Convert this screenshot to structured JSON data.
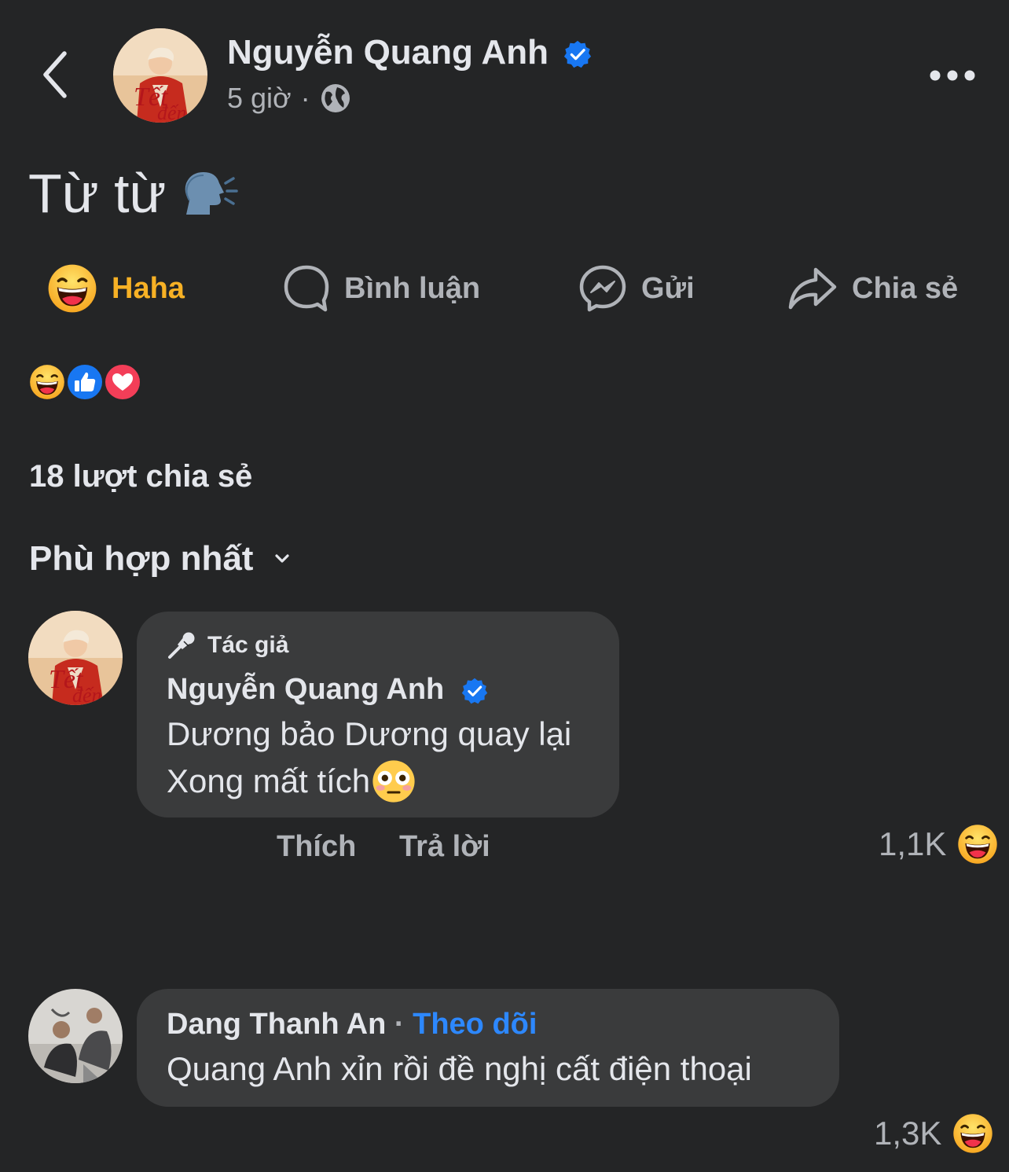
{
  "post": {
    "author": "Nguyễn Quang Anh",
    "time": "5 giờ",
    "separator": "·",
    "text": "Từ từ",
    "text_emoji": "speaking-head-icon"
  },
  "actions": {
    "haha": "Haha",
    "comment": "Bình luận",
    "send": "Gửi",
    "share": "Chia sẻ"
  },
  "reactions": [
    "haha-icon",
    "like-icon",
    "love-icon"
  ],
  "share_count": "18 lượt chia sẻ",
  "sort": {
    "label": "Phù hợp nhất"
  },
  "comments": [
    {
      "badge": "Tác giả",
      "name": "Nguyễn Quang Anh",
      "line1": "Dương bảo Dương quay lại",
      "line2": "Xong mất tích",
      "like": "Thích",
      "reply": "Trả lời",
      "reaction_count": "1,1K"
    },
    {
      "name": "Dang Thanh An",
      "separator": "·",
      "follow": "Theo dõi",
      "text": "Quang Anh xỉn rồi đề nghị cất điện thoại",
      "reaction_count": "1,3K"
    }
  ],
  "colors": {
    "background": "#242526",
    "bubble": "#3a3b3c",
    "text": "#e4e6eb",
    "secondary": "#b0b3b8",
    "haha": "#f7b125",
    "link": "#2d88ff",
    "verified": "#1877f2"
  }
}
